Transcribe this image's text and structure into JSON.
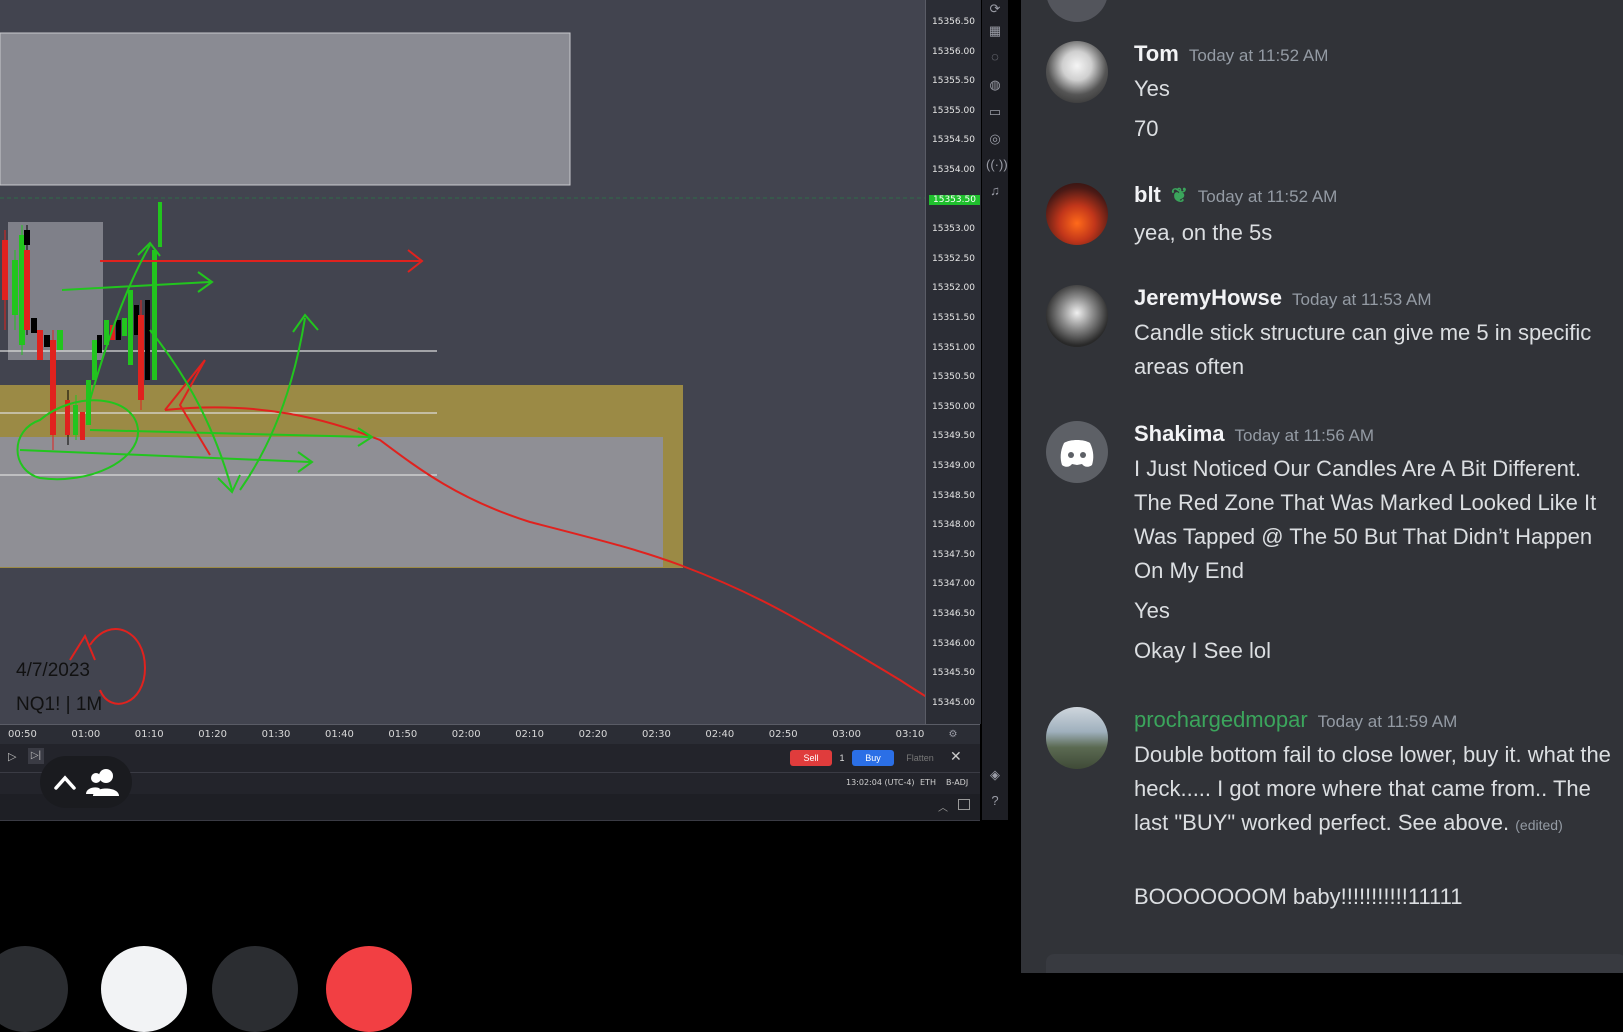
{
  "chart": {
    "prices": [
      "15356.50",
      "15356.00",
      "15355.50",
      "15355.00",
      "15354.50",
      "15354.00",
      "15353.50",
      "15353.00",
      "15352.50",
      "15352.00",
      "15351.50",
      "15351.00",
      "15350.50",
      "15350.00",
      "15349.50",
      "15349.00",
      "15348.50",
      "15348.00",
      "15347.50",
      "15347.00",
      "15346.50",
      "15346.00",
      "15345.50",
      "15345.00"
    ],
    "current_price": "15353.50",
    "times": [
      "00:50",
      "01:00",
      "01:10",
      "01:20",
      "01:30",
      "01:40",
      "01:50",
      "02:00",
      "02:10",
      "02:20",
      "02:30",
      "02:40",
      "02:50",
      "03:00",
      "03:10"
    ],
    "date_label": "4/7/2023",
    "symbol_label": "NQ1! | 1M"
  },
  "trade_bar": {
    "sell_label": "Sell",
    "quantity": "1",
    "buy_label": "Buy",
    "flatten_label": "Flatten",
    "clock": "13:02:04 (UTC-4)",
    "session": "ETH",
    "adjust": "B-ADJ"
  },
  "messages": [
    {
      "user": "Tom",
      "time": "Today at 11:52 AM",
      "lines": [
        "Yes",
        "70"
      ],
      "name_color": "#f2f3f5"
    },
    {
      "user": "blt",
      "time": "Today at 11:52 AM",
      "lines": [
        "yea, on the 5s"
      ],
      "name_color": "#f2f3f5",
      "badge": "leaf-badge-icon"
    },
    {
      "user": "JeremyHowse",
      "time": "Today at 11:53 AM",
      "lines": [
        "Candle stick structure can give me 5 in specific areas often"
      ],
      "name_color": "#f2f3f5"
    },
    {
      "user": "Shakima",
      "time": "Today at 11:56 AM",
      "lines": [
        "I Just Noticed Our Candles Are A Bit Different. The Red Zone That Was Marked Looked Like It Was Tapped @ The 50 But That Didn’t Happen On My End",
        "Yes",
        "Okay I See lol"
      ],
      "name_color": "#f2f3f5"
    },
    {
      "user": "prochargedmopar",
      "time": "Today at 11:59 AM",
      "lines": [
        "Double bottom fail to close lower, buy it. what the heck..... I got more where that came from.. The last \"BUY\" worked perfect.  See above.",
        "BOOOOOOOM baby!!!!!!!!!!!11111"
      ],
      "edited": "(edited)",
      "name_color": "#3ba55c"
    }
  ],
  "colors": {
    "chat_bg": "#313338",
    "chart_bg": "#42444f",
    "zone_gold": "#9b8a45",
    "zone_gray": "#8a8b93",
    "drawing_red": "#e0221e",
    "drawing_green": "#22c51e"
  }
}
